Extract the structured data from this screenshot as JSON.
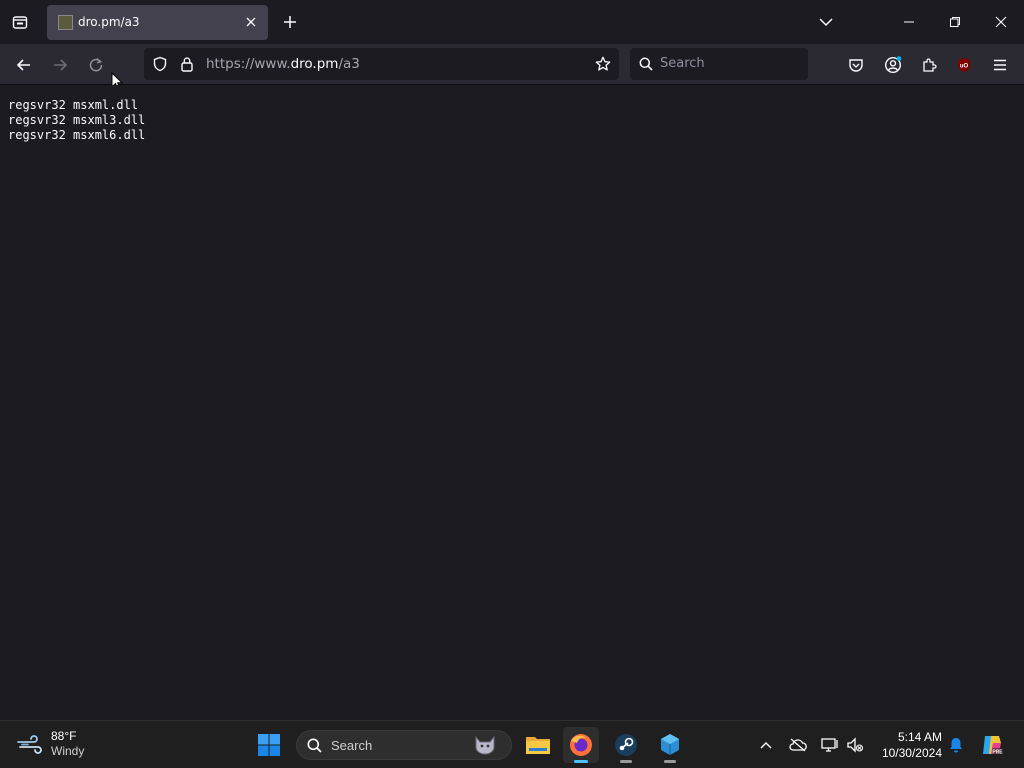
{
  "browser": {
    "tab": {
      "title": "dro.pm/a3"
    },
    "url": {
      "prefix": "https://www.",
      "host": "dro.pm",
      "path": "/a3"
    },
    "search_placeholder": "Search"
  },
  "page": {
    "lines": [
      "regsvr32 msxml.dll",
      "regsvr32 msxml3.dll",
      "regsvr32 msxml6.dll"
    ]
  },
  "taskbar": {
    "weather": {
      "temp": "88°F",
      "condition": "Windy"
    },
    "search_placeholder": "Search",
    "clock": {
      "time": "5:14 AM",
      "date": "10/30/2024"
    }
  },
  "colors": {
    "accent": "#0078d4",
    "firefox": "#ff7139"
  }
}
